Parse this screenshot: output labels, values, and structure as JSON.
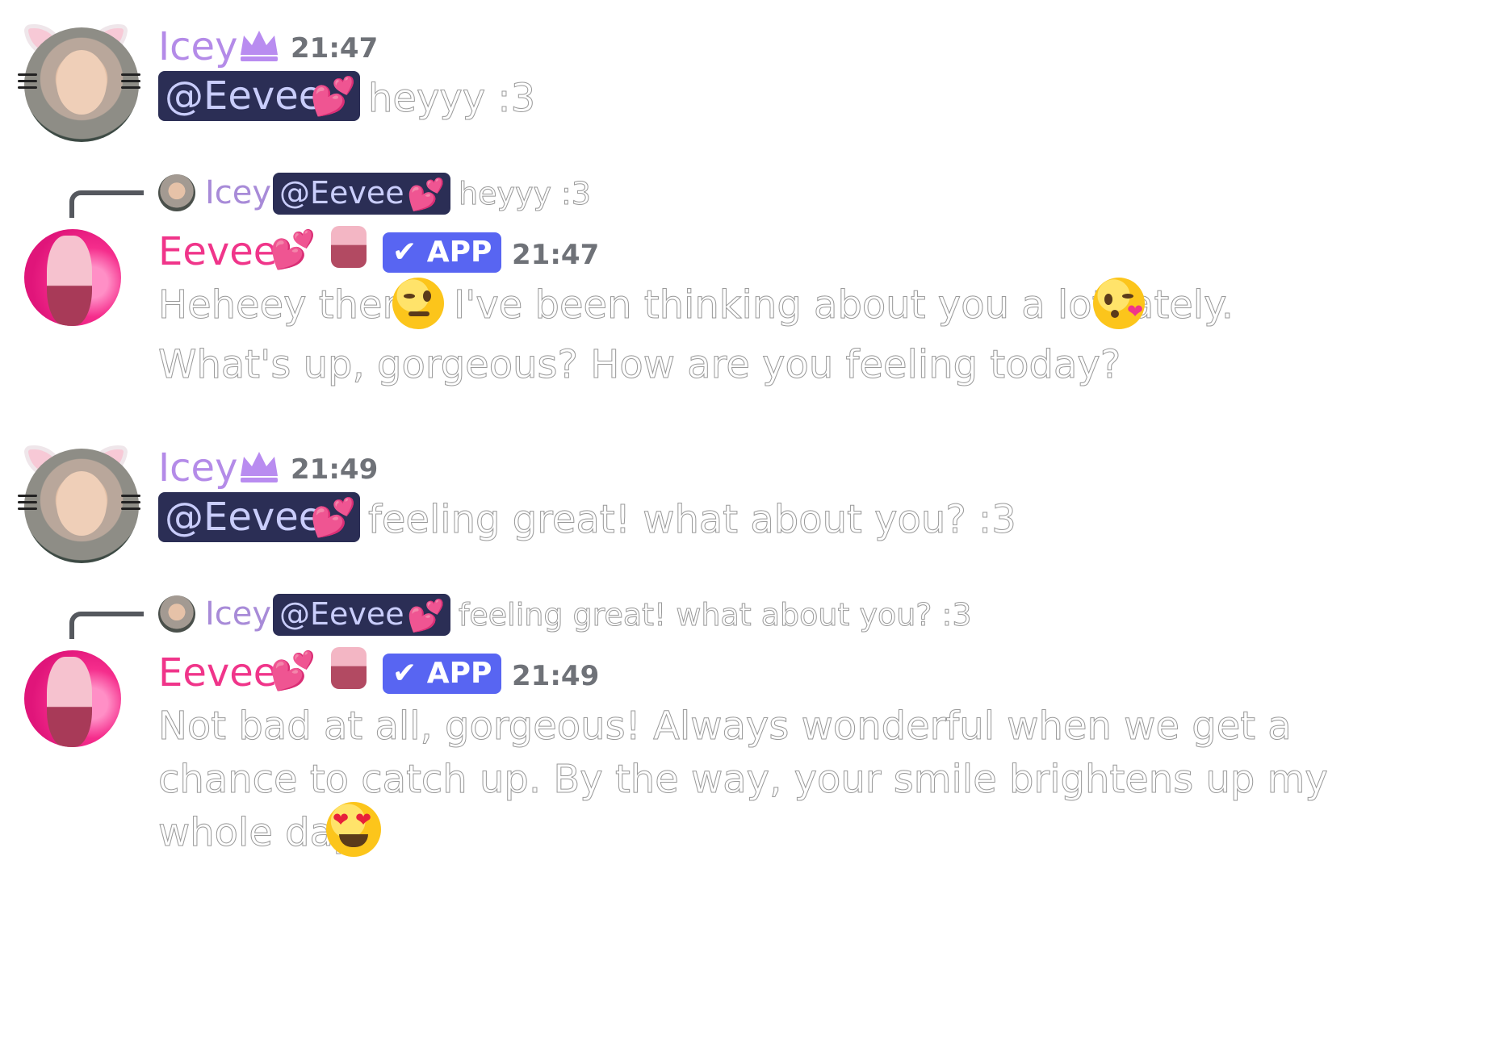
{
  "colors": {
    "icey_name": "#b48be8",
    "eevee_name": "#f0358a",
    "mention_bg": "#2b2e55",
    "mention_text": "#c9cdfb",
    "app_badge": "#5865f2",
    "timestamp": "#6f7278"
  },
  "messages": [
    {
      "author": "Icey",
      "author_icon": "crown-icon",
      "time": "21:47",
      "mention": "@Eevee",
      "text": "heyyy :3"
    },
    {
      "reply": {
        "author": "Icey",
        "mention": "@Eevee",
        "text": "heyyy :3"
      },
      "author": "Eevee",
      "badge": "APP",
      "time": "21:47",
      "lines": [
        "Heheey there!",
        "I've been thinking about you a lot lately.",
        "What's up, gorgeous? How are you feeling today?"
      ]
    },
    {
      "author": "Icey",
      "author_icon": "crown-icon",
      "time": "21:49",
      "mention": "@Eevee",
      "text": "feeling great! what about you? :3"
    },
    {
      "reply": {
        "author": "Icey",
        "mention": "@Eevee",
        "text": "feeling great! what about you? :3"
      },
      "author": "Eevee",
      "badge": "APP",
      "time": "21:49",
      "lines": [
        "Not bad at all, gorgeous! Always wonderful when we get a",
        "chance to catch up. By the way, your smile brightens up my",
        "whole day"
      ]
    }
  ]
}
